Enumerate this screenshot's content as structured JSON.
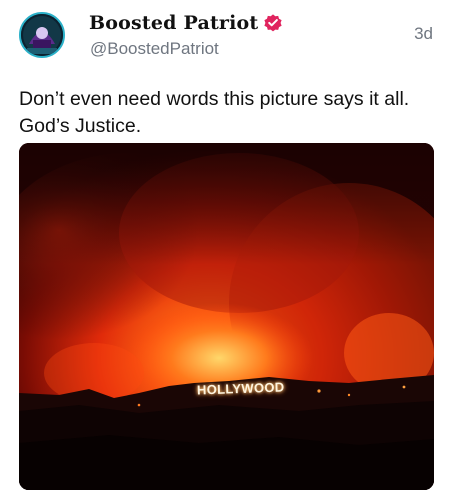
{
  "author": {
    "display_name": "Boosted Patriot",
    "handle": "@BoostedPatriot",
    "verified": true,
    "verified_color": "#e0245e",
    "avatar_icon": "patriot-avatar-icon"
  },
  "post": {
    "timestamp": "3d",
    "text": "Don’t even need words this picture says it all. God’s Justice.",
    "image": {
      "description_icon": "wildfire-photo",
      "sign_text": "HOLLYWOOD"
    }
  },
  "colors": {
    "text": "#111111",
    "muted": "#6f7680",
    "fire_orange": "#ff5a1a",
    "fire_deep": "#8a0f05"
  }
}
